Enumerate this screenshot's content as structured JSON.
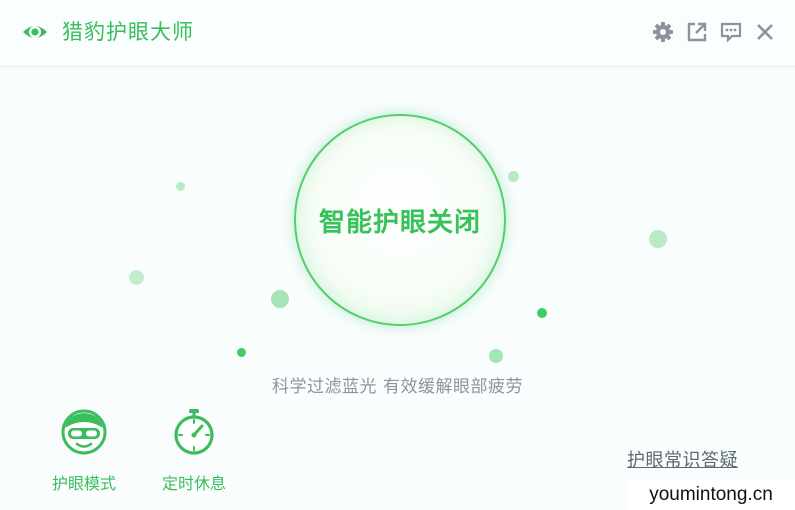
{
  "app": {
    "title": "猎豹护眼大师"
  },
  "toolbar": {
    "icons": [
      "gear-icon",
      "external-link-icon",
      "feedback-icon",
      "close-icon"
    ]
  },
  "main": {
    "toggle_label": "智能护眼关闭",
    "tagline": "科学过滤蓝光 有效缓解眼部疲劳"
  },
  "features": [
    {
      "label": "护眼模式",
      "icon": "goggles-face-icon"
    },
    {
      "label": "定时休息",
      "icon": "stopwatch-icon"
    }
  ],
  "links": {
    "faq": "护眼常识答疑"
  },
  "watermark": "youmintong.cn",
  "colors": {
    "accent": "#36bf5b",
    "background": "#f9fdfe",
    "muted_text": "#8c959a"
  }
}
